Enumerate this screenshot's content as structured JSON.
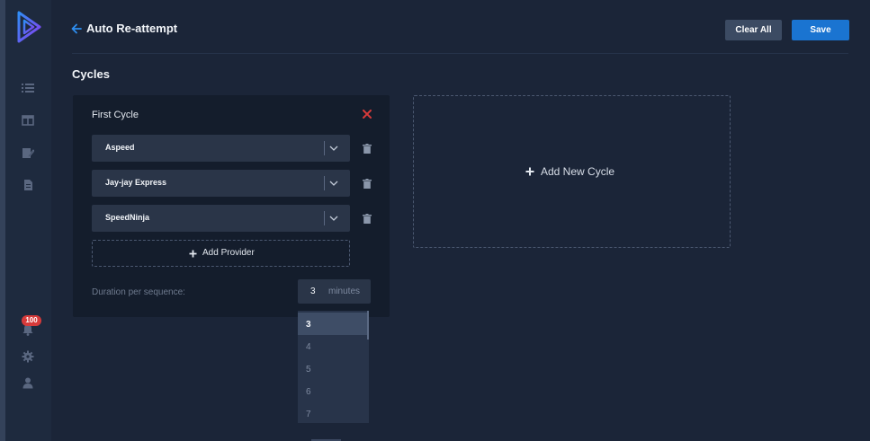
{
  "header": {
    "title": "Auto Re-attempt",
    "clear_label": "Clear All",
    "save_label": "Save"
  },
  "sidebar": {
    "notification_count": "100",
    "icons": [
      "logo-icon",
      "list-icon",
      "layout-icon",
      "edit-icon",
      "document-icon",
      "bell-icon",
      "gear-icon",
      "user-icon"
    ]
  },
  "section_title": "Cycles",
  "cycle": {
    "title": "First Cycle",
    "providers": [
      {
        "label": "Aspeed"
      },
      {
        "label": "Jay-jay Express"
      },
      {
        "label": "SpeedNinja"
      }
    ],
    "add_provider_label": "Add Provider",
    "duration_label": "Duration per sequence:",
    "duration_value": "3",
    "duration_unit": "minutes",
    "duration_options": [
      "3",
      "4",
      "5",
      "6",
      "7"
    ],
    "duration_selected": "3"
  },
  "add_cycle_label": "Add New Cycle",
  "colors": {
    "background": "#1b2538",
    "sidebar": "#1e2a3e",
    "card": "#141d2c",
    "input": "#2a3548",
    "accent": "#1a74d1",
    "danger": "#d73a3a",
    "logo_gradient": [
      "#2f8df5",
      "#8b3cf0"
    ]
  }
}
